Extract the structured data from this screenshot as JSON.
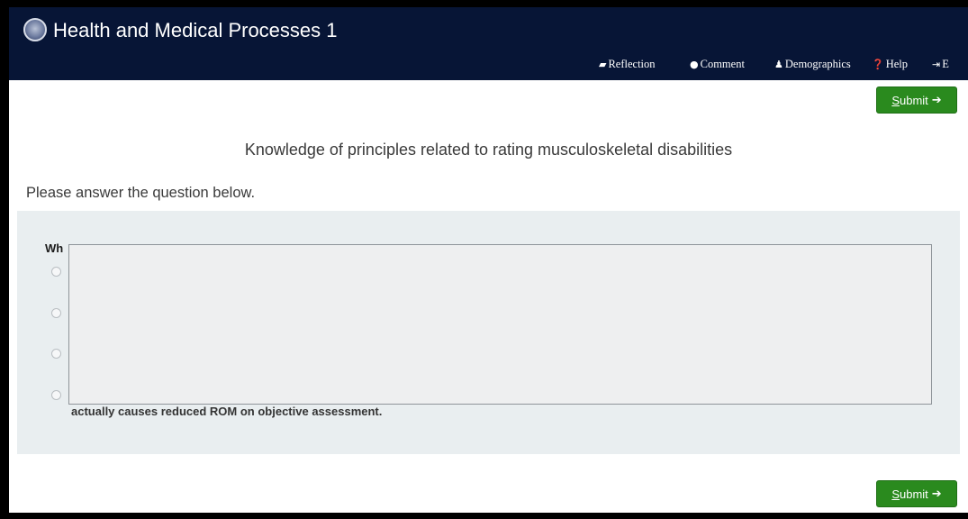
{
  "header": {
    "title": "Health and Medical Processes 1",
    "nav": [
      {
        "label": "Reflection",
        "icon": "folder-open-icon",
        "glyph": "📂"
      },
      {
        "label": "Comment",
        "icon": "comment-icon",
        "glyph": "💬"
      },
      {
        "label": "Demographics",
        "icon": "user-icon",
        "glyph": "👤"
      },
      {
        "label": "Help",
        "icon": "question-circle-icon",
        "glyph": "?"
      },
      {
        "label": "E",
        "icon": "sign-out-icon",
        "glyph": "⇥"
      }
    ]
  },
  "submit": {
    "label": "Submit",
    "arrow": "➔"
  },
  "content": {
    "topic": "Knowledge of principles related to rating musculoskeletal disabilities",
    "prompt": "Please answer the question below."
  },
  "question": {
    "text": "Wh",
    "options": [
      {
        "text": ""
      },
      {
        "text": ""
      },
      {
        "text": ""
      },
      {
        "text": "actually causes reduced ROM on objective assessment."
      }
    ]
  },
  "colors": {
    "header_bg": "#071536",
    "submit_bg": "#2a8a1e",
    "panel_bg": "#e9eef0"
  }
}
